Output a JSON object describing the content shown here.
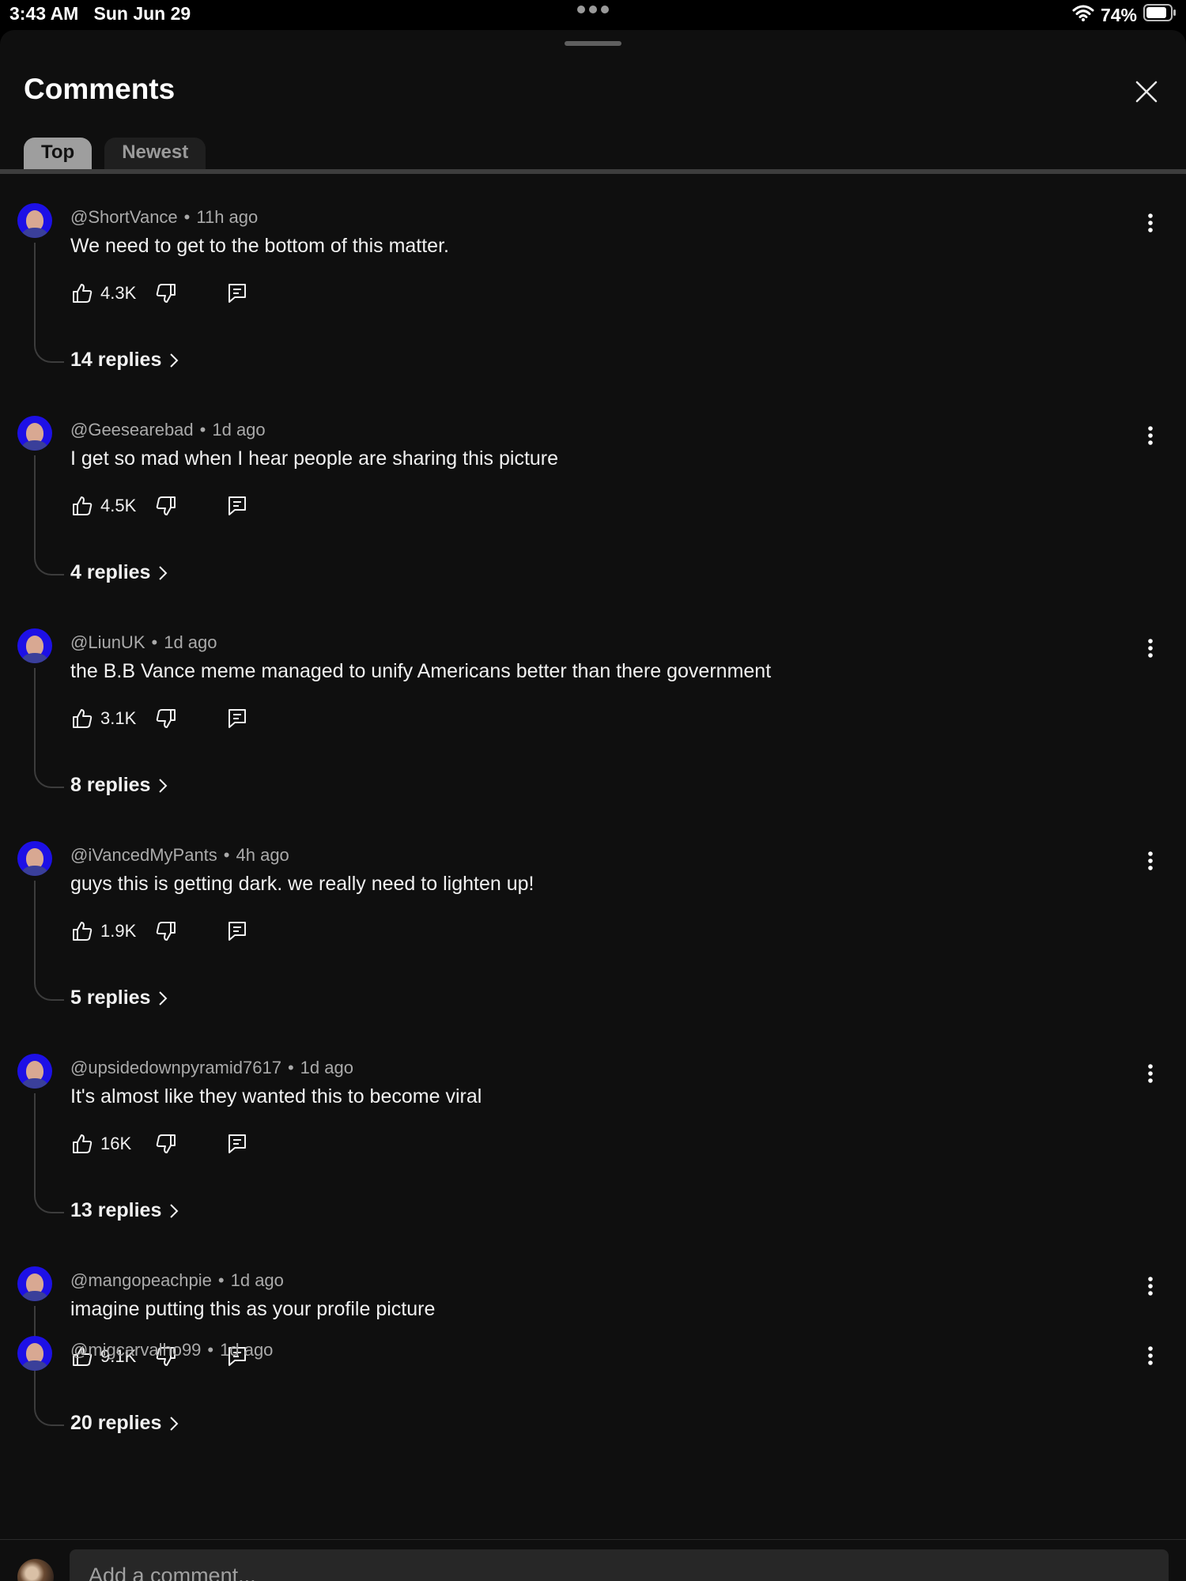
{
  "status_bar": {
    "time": "3:43 AM",
    "date": "Sun Jun 29",
    "battery": "74%"
  },
  "sheet": {
    "title": "Comments"
  },
  "tabs": [
    {
      "label": "Top",
      "active": true
    },
    {
      "label": "Newest",
      "active": false
    }
  ],
  "comments": [
    {
      "author": "@ShortVance",
      "time": "11h ago",
      "text": "We need to get to the bottom of this matter.",
      "likes": "4.3K",
      "replies": "14 replies"
    },
    {
      "author": "@Geesearebad",
      "time": "1d ago",
      "text": "I get so mad when I hear people are sharing this picture",
      "likes": "4.5K",
      "replies": "4 replies"
    },
    {
      "author": "@LiunUK",
      "time": "1d ago",
      "text": "the B.B Vance meme managed to unify Americans better than there government",
      "likes": "3.1K",
      "replies": "8 replies"
    },
    {
      "author": "@iVancedMyPants",
      "time": "4h ago",
      "text": "guys this is getting dark. we really need to lighten up!",
      "likes": "1.9K",
      "replies": "5 replies"
    },
    {
      "author": "@upsidedownpyramid7617",
      "time": "1d ago",
      "text": "It's almost like they wanted this to become viral",
      "likes": "16K",
      "replies": "13 replies"
    },
    {
      "author": "@mangopeachpie",
      "time": "1d ago",
      "text": "imagine putting this as your profile picture",
      "likes": "9.1K",
      "replies": "20 replies"
    }
  ],
  "partial_comment": {
    "author": "@migcarvalho99",
    "time": "1d ago"
  },
  "composer": {
    "placeholder": "Add a comment..."
  },
  "colors": {
    "background": "#0f0f0f",
    "avatar_bg": "#1d10e6",
    "input_bg": "#272727",
    "muted_text": "#aaaaaa"
  }
}
